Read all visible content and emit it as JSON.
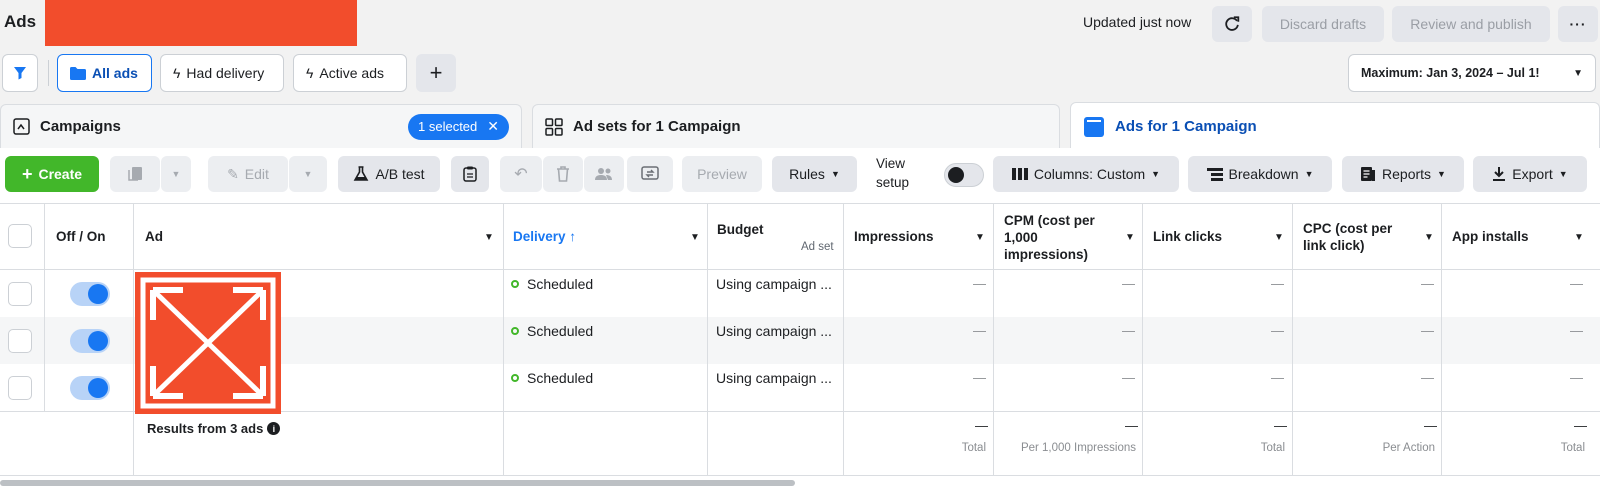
{
  "header": {
    "title": "Ads",
    "updated": "Updated just now",
    "discard_label": "Discard drafts",
    "review_label": "Review and publish",
    "more_label": "···"
  },
  "filters": {
    "all_ads": "All ads",
    "had_delivery": "Had delivery",
    "active_ads": "Active ads",
    "add": "+",
    "date_range": "Maximum: Jan 3, 2024 – Jul 1!"
  },
  "tabs": {
    "campaigns": "Campaigns",
    "selected": "1 selected",
    "adsets": "Ad sets for 1 Campaign",
    "ads": "Ads for 1 Campaign"
  },
  "toolbar": {
    "create": "Create",
    "edit": "Edit",
    "ab_test": "A/B test",
    "preview": "Preview",
    "rules": "Rules",
    "view_setup_line1": "View",
    "view_setup_line2": "setup",
    "columns": "Columns: Custom",
    "breakdown": "Breakdown",
    "reports": "Reports",
    "export": "Export"
  },
  "table": {
    "headers": {
      "off_on": "Off / On",
      "ad": "Ad",
      "delivery": "Delivery ↑",
      "budget": "Budget",
      "budget_sub": "Ad set",
      "impressions": "Impressions",
      "cpm_1": "CPM (cost per",
      "cpm_2": "1,000",
      "cpm_3": "impressions)",
      "link_clicks": "Link clicks",
      "cpc_1": "CPC (cost per",
      "cpc_2": "link click)",
      "app_installs": "App installs"
    },
    "rows": [
      {
        "delivery": "Scheduled",
        "budget": "Using campaign ...",
        "impressions": "—",
        "cpm": "—",
        "link_clicks": "—",
        "cpc": "—",
        "app_installs": "—"
      },
      {
        "delivery": "Scheduled",
        "budget": "Using campaign ...",
        "impressions": "—",
        "cpm": "—",
        "link_clicks": "—",
        "cpc": "—",
        "app_installs": "—"
      },
      {
        "delivery": "Scheduled",
        "budget": "Using campaign ...",
        "impressions": "—",
        "cpm": "—",
        "link_clicks": "—",
        "cpc": "—",
        "app_installs": "—"
      }
    ],
    "footer": {
      "results": "Results from 3 ads",
      "impressions": "—",
      "impressions_label": "Total",
      "cpm": "—",
      "cpm_label": "Per 1,000 Impressions",
      "link_clicks": "—",
      "link_clicks_label": "Total",
      "cpc": "—",
      "cpc_label": "Per Action",
      "app_installs": "—",
      "app_installs_label": "Total"
    }
  },
  "colors": {
    "accent": "#1877f2",
    "create_green": "#42b72a",
    "redaction": "#f24d2c"
  }
}
